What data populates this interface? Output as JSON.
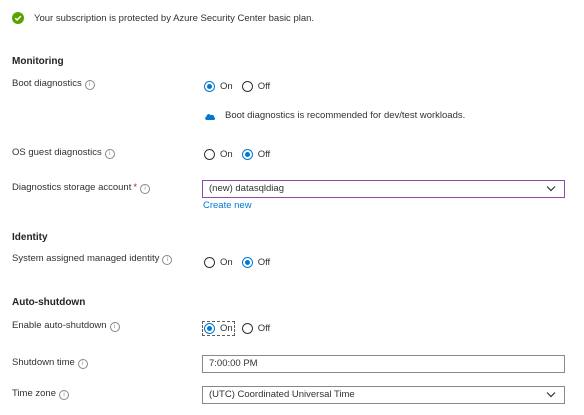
{
  "banner": {
    "text": "Your subscription is protected by Azure Security Center basic plan."
  },
  "monitoring": {
    "heading": "Monitoring",
    "boot_diagnostics": {
      "label": "Boot diagnostics",
      "options": [
        {
          "label": "On",
          "checked": true
        },
        {
          "label": "Off",
          "checked": false
        }
      ],
      "note": "Boot diagnostics is recommended for dev/test workloads."
    },
    "os_guest_diagnostics": {
      "label": "OS guest diagnostics",
      "options": [
        {
          "label": "On",
          "checked": false
        },
        {
          "label": "Off",
          "checked": true
        }
      ]
    },
    "diagnostics_storage": {
      "label": "Diagnostics storage account",
      "required_marker": "*",
      "value": "(new) datasqldiag",
      "create_new": "Create new"
    }
  },
  "identity": {
    "heading": "Identity",
    "system_identity": {
      "label": "System assigned managed identity",
      "options": [
        {
          "label": "On",
          "checked": false
        },
        {
          "label": "Off",
          "checked": true
        }
      ]
    }
  },
  "auto_shutdown": {
    "heading": "Auto-shutdown",
    "enable": {
      "label": "Enable auto-shutdown",
      "options": [
        {
          "label": "On",
          "checked": true
        },
        {
          "label": "Off",
          "checked": false
        }
      ]
    },
    "shutdown_time": {
      "label": "Shutdown time",
      "value": "7:00:00 PM"
    },
    "time_zone": {
      "label": "Time zone",
      "value": "(UTC) Coordinated Universal Time"
    }
  },
  "info_glyph": "i",
  "colors": {
    "accent": "#0078d4",
    "success": "#57a300",
    "focus_border": "#8b4aa8"
  }
}
